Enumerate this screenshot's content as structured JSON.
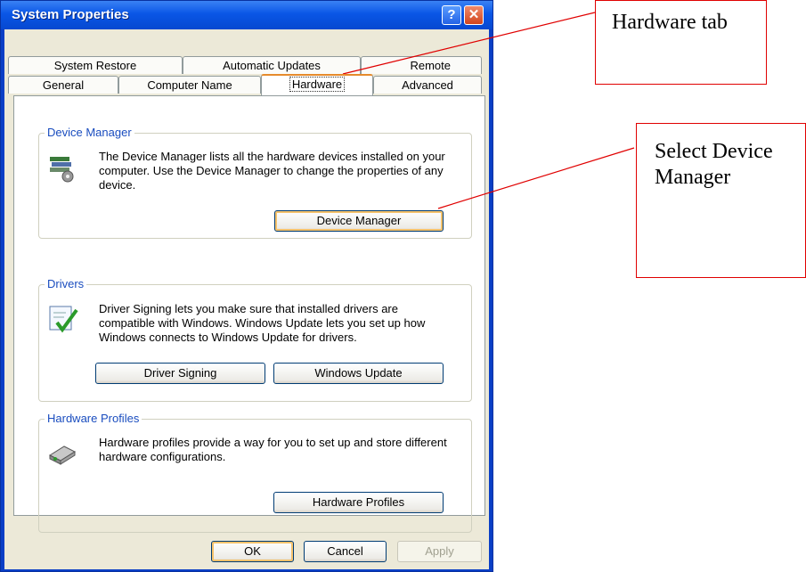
{
  "window": {
    "title": "System Properties",
    "help_glyph": "?",
    "close_glyph": "✕"
  },
  "tabs": {
    "row1": [
      "System Restore",
      "Automatic Updates",
      "Remote"
    ],
    "row2": [
      "General",
      "Computer Name",
      "Hardware",
      "Advanced"
    ],
    "active": "Hardware"
  },
  "device_manager": {
    "title": "Device Manager",
    "description": "The Device Manager lists all the hardware devices installed on your computer. Use the Device Manager to change the properties of any device.",
    "button": "Device Manager"
  },
  "drivers": {
    "title": "Drivers",
    "description": "Driver Signing lets you make sure that installed drivers are compatible with Windows. Windows Update lets you set up how Windows connects to Windows Update for drivers.",
    "signing_button": "Driver Signing",
    "update_button": "Windows Update"
  },
  "hardware_profiles": {
    "title": "Hardware Profiles",
    "description": "Hardware profiles provide a way for you to set up and store different hardware configurations.",
    "button": "Hardware Profiles"
  },
  "footer": {
    "ok": "OK",
    "cancel": "Cancel",
    "apply": "Apply"
  },
  "annotations": {
    "hardware_tab": "Hardware tab",
    "select_device_manager": "Select Device Manager"
  },
  "colors": {
    "callout_border": "#e00000",
    "title_bar": "#0a56e6",
    "group_title": "#1a4dbf"
  },
  "icons": [
    "help-icon",
    "close-icon",
    "device-manager-icon",
    "driver-signing-icon",
    "hardware-profiles-icon"
  ]
}
